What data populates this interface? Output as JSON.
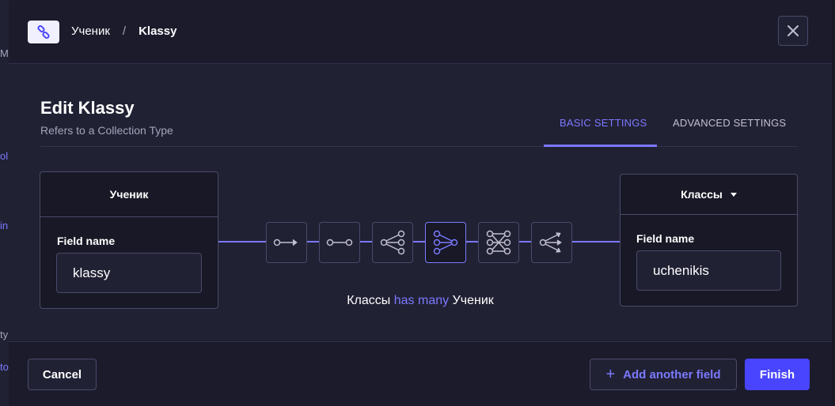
{
  "background_fragments": {
    "f1": "Ma",
    "f2": "ol",
    "f3": "in",
    "f4": "ty",
    "f5": "to"
  },
  "header": {
    "icon": "link-icon",
    "breadcrumb": {
      "parent": "Ученик",
      "separator": "/",
      "current": "Klassy"
    },
    "close_icon": "close-icon"
  },
  "main": {
    "title": "Edit Klassy",
    "subtitle": "Refers to a Collection Type",
    "tabs": [
      {
        "label": "BASIC SETTINGS",
        "active": true
      },
      {
        "label": "ADVANCED SETTINGS",
        "active": false
      }
    ]
  },
  "left_box": {
    "header": "Ученик",
    "field_label": "Field name",
    "field_value": "klassy"
  },
  "right_box": {
    "header": "Классы",
    "field_label": "Field name",
    "field_value": "uchenikis"
  },
  "relations": [
    {
      "icon": "one-way-icon",
      "active": false
    },
    {
      "icon": "one-to-one-icon",
      "active": false
    },
    {
      "icon": "one-to-many-icon",
      "active": false
    },
    {
      "icon": "many-to-one-icon",
      "active": true
    },
    {
      "icon": "many-to-many-icon",
      "active": false
    },
    {
      "icon": "many-way-icon",
      "active": false
    }
  ],
  "relation_text": {
    "left": "Классы",
    "middle": "has many",
    "right": "Ученик"
  },
  "footer": {
    "cancel_label": "Cancel",
    "add_label": "Add another field",
    "finish_label": "Finish"
  },
  "colors": {
    "accent": "#7b79ff",
    "primary": "#4945ff",
    "background": "#212134"
  }
}
